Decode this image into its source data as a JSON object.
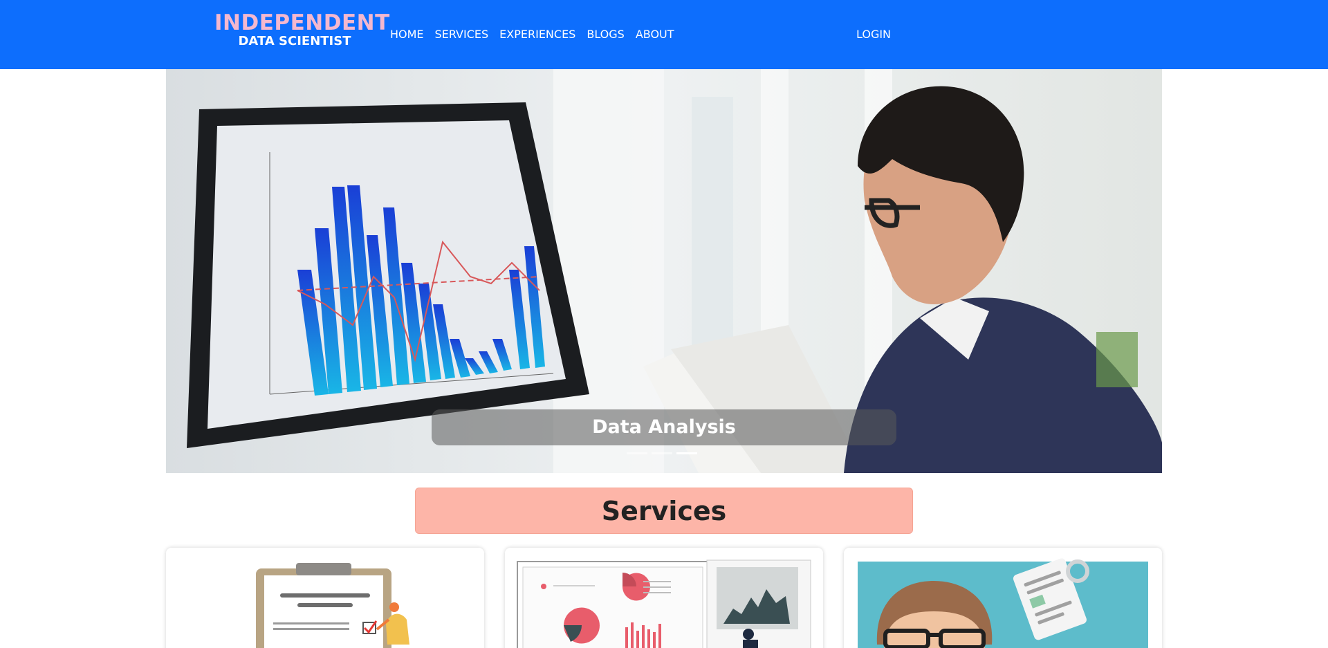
{
  "brand": {
    "line1": "INDEPENDENT",
    "line2": "DATA SCIENTIST"
  },
  "nav": {
    "items": [
      "HOME",
      "SERVICES",
      "EXPERIENCES",
      "BLOGS",
      "ABOUT"
    ],
    "login": "LOGIN"
  },
  "hero": {
    "caption": "Data Analysis",
    "slide_count": 3,
    "active_slide": 3
  },
  "services": {
    "title": "Services"
  },
  "colors": {
    "navbar": "#0d6efd",
    "brand_accent": "#f4b8cf",
    "services_banner": "#fdb5a8"
  }
}
